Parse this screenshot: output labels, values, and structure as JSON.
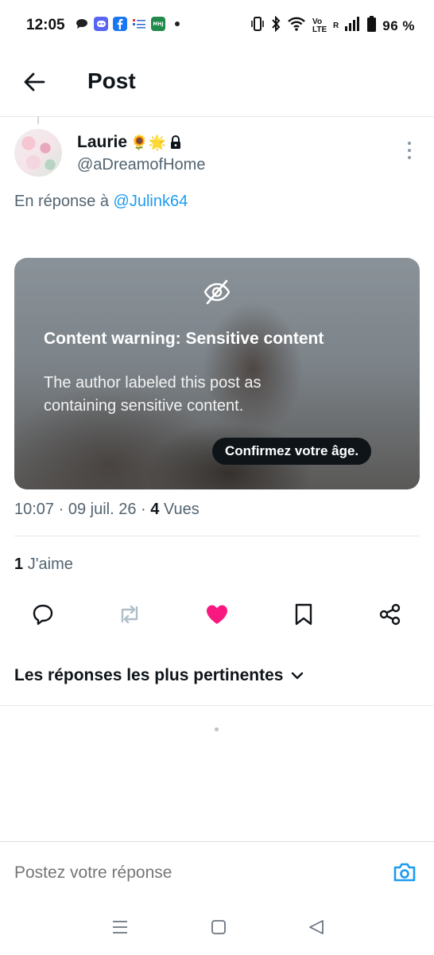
{
  "status_bar": {
    "time": "12:05",
    "network_label": "Vo LTE",
    "roaming": "R",
    "battery": "96 %",
    "notification_icons": [
      "chat-icon",
      "discord-icon",
      "facebook-icon",
      "list-app-icon",
      "green-app-icon",
      "dot-icon"
    ],
    "green_app_text": "MHJ",
    "system_icons": [
      "vibrate-icon",
      "bluetooth-icon",
      "wifi-icon",
      "signal-icon",
      "battery-icon"
    ]
  },
  "header": {
    "title": "Post",
    "back_icon": "arrow-left-icon"
  },
  "post": {
    "author_name": "Laurie",
    "author_emojis": "🌻🌟",
    "locked_icon": "lock-icon",
    "handle": "@aDreamofHome",
    "reply_prefix": "En réponse à",
    "reply_mention": "@Julink64",
    "media": {
      "icon": "eye-off-icon",
      "warning_title": "Content warning: Sensitive content",
      "warning_text": "The author labeled this post as containing sensitive content.",
      "confirm_label": "Confirmez votre âge."
    },
    "timestamp": "10:07 · 09 juil. 26 ·",
    "views_count": "4",
    "views_label": "Vues",
    "likes_count": "1",
    "likes_label": "J'aime"
  },
  "actions": [
    {
      "icon": "reply-icon"
    },
    {
      "icon": "repost-icon"
    },
    {
      "icon": "heart-icon",
      "active": true
    },
    {
      "icon": "bookmark-icon"
    },
    {
      "icon": "share-icon"
    }
  ],
  "replies": {
    "sort_label": "Les réponses les plus pertinentes",
    "sort_icon": "chevron-down-icon"
  },
  "composer": {
    "placeholder": "Postez votre réponse",
    "camera_icon": "camera-icon"
  },
  "nav": [
    "recents-icon",
    "home-icon",
    "back-icon"
  ],
  "colors": {
    "accent": "#1d9bf0",
    "like": "#f91880",
    "text_primary": "#0f1419",
    "text_secondary": "#536471"
  }
}
